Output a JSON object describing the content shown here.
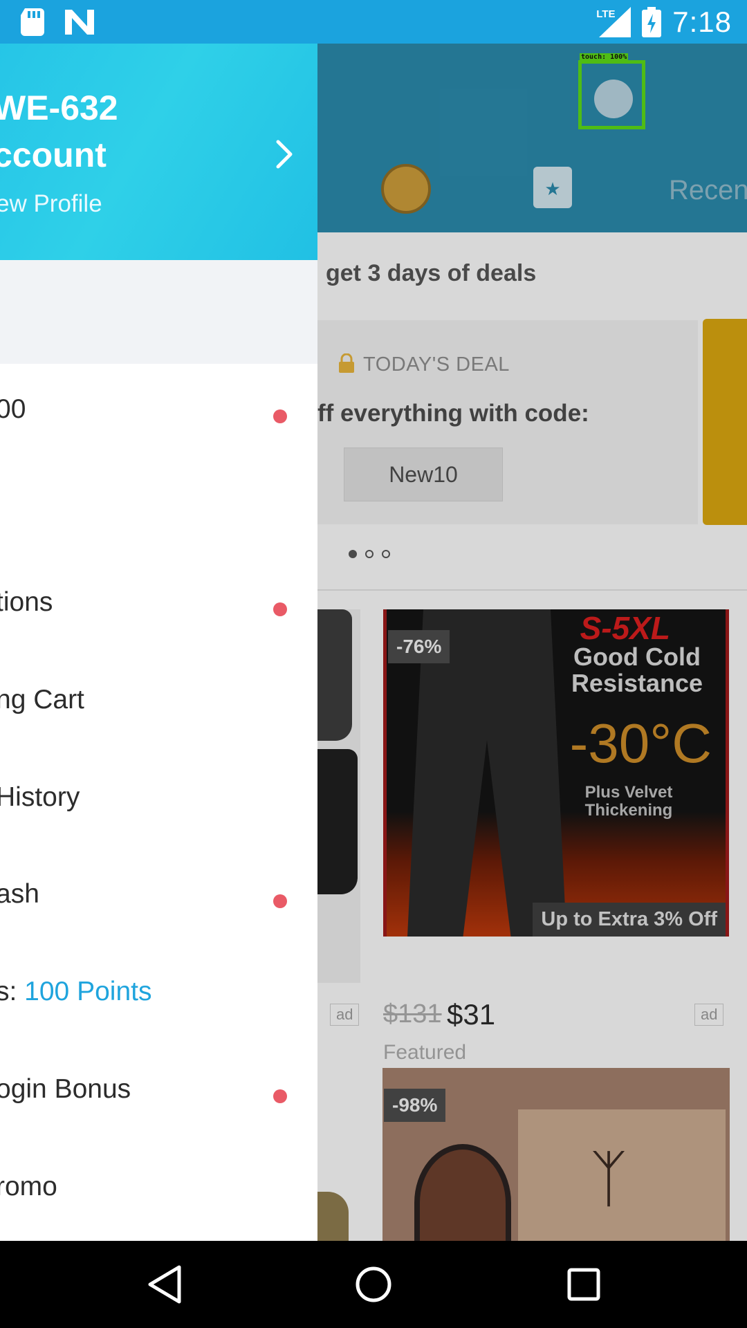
{
  "status_bar": {
    "time": "7:18",
    "network": "LTE",
    "icons": [
      "sd-card-icon",
      "n-logo-icon",
      "signal-icon",
      "battery-charging-icon"
    ]
  },
  "drawer": {
    "account_name": "WE-632",
    "account_label": "ccount",
    "view_profile": "ew Profile",
    "items": [
      {
        "label": "00",
        "has_dot": true
      },
      {
        "label": "tions",
        "has_dot": true
      },
      {
        "label": "ng Cart",
        "has_dot": false
      },
      {
        "label": "History",
        "has_dot": false
      },
      {
        "label": "ash",
        "has_dot": true
      },
      {
        "label": "s: ",
        "points": "100 Points",
        "has_dot": false
      },
      {
        "label": "ogin Bonus",
        "has_dot": true
      },
      {
        "label": "romo",
        "has_dot": false
      }
    ]
  },
  "app": {
    "header": {
      "recent": "Recen",
      "touch_label": "touch: 100%"
    },
    "deals_banner": "get 3 days of deals",
    "deal": {
      "tag": "TODAY'S DEAL",
      "text": "ff everything with code:",
      "code": "New10"
    },
    "product1": {
      "discount": "-76%",
      "size_text": "S-5XL",
      "headline": "Good Cold Resistance",
      "temp": "-30°C",
      "sub": "Plus Velvet Thickening",
      "promo": "Up to Extra 3% Off",
      "old_price": "$131",
      "price": "$31",
      "featured": "Featured",
      "ad": "ad"
    },
    "product2": {
      "discount": "-98%"
    },
    "left_ad": "ad"
  },
  "colors": {
    "status_bar": "#1ba3de",
    "drawer_header": "#26c5e7",
    "points": "#1fa4dd",
    "notification_dot": "#e95a66",
    "touch_box": "#5ad619"
  }
}
